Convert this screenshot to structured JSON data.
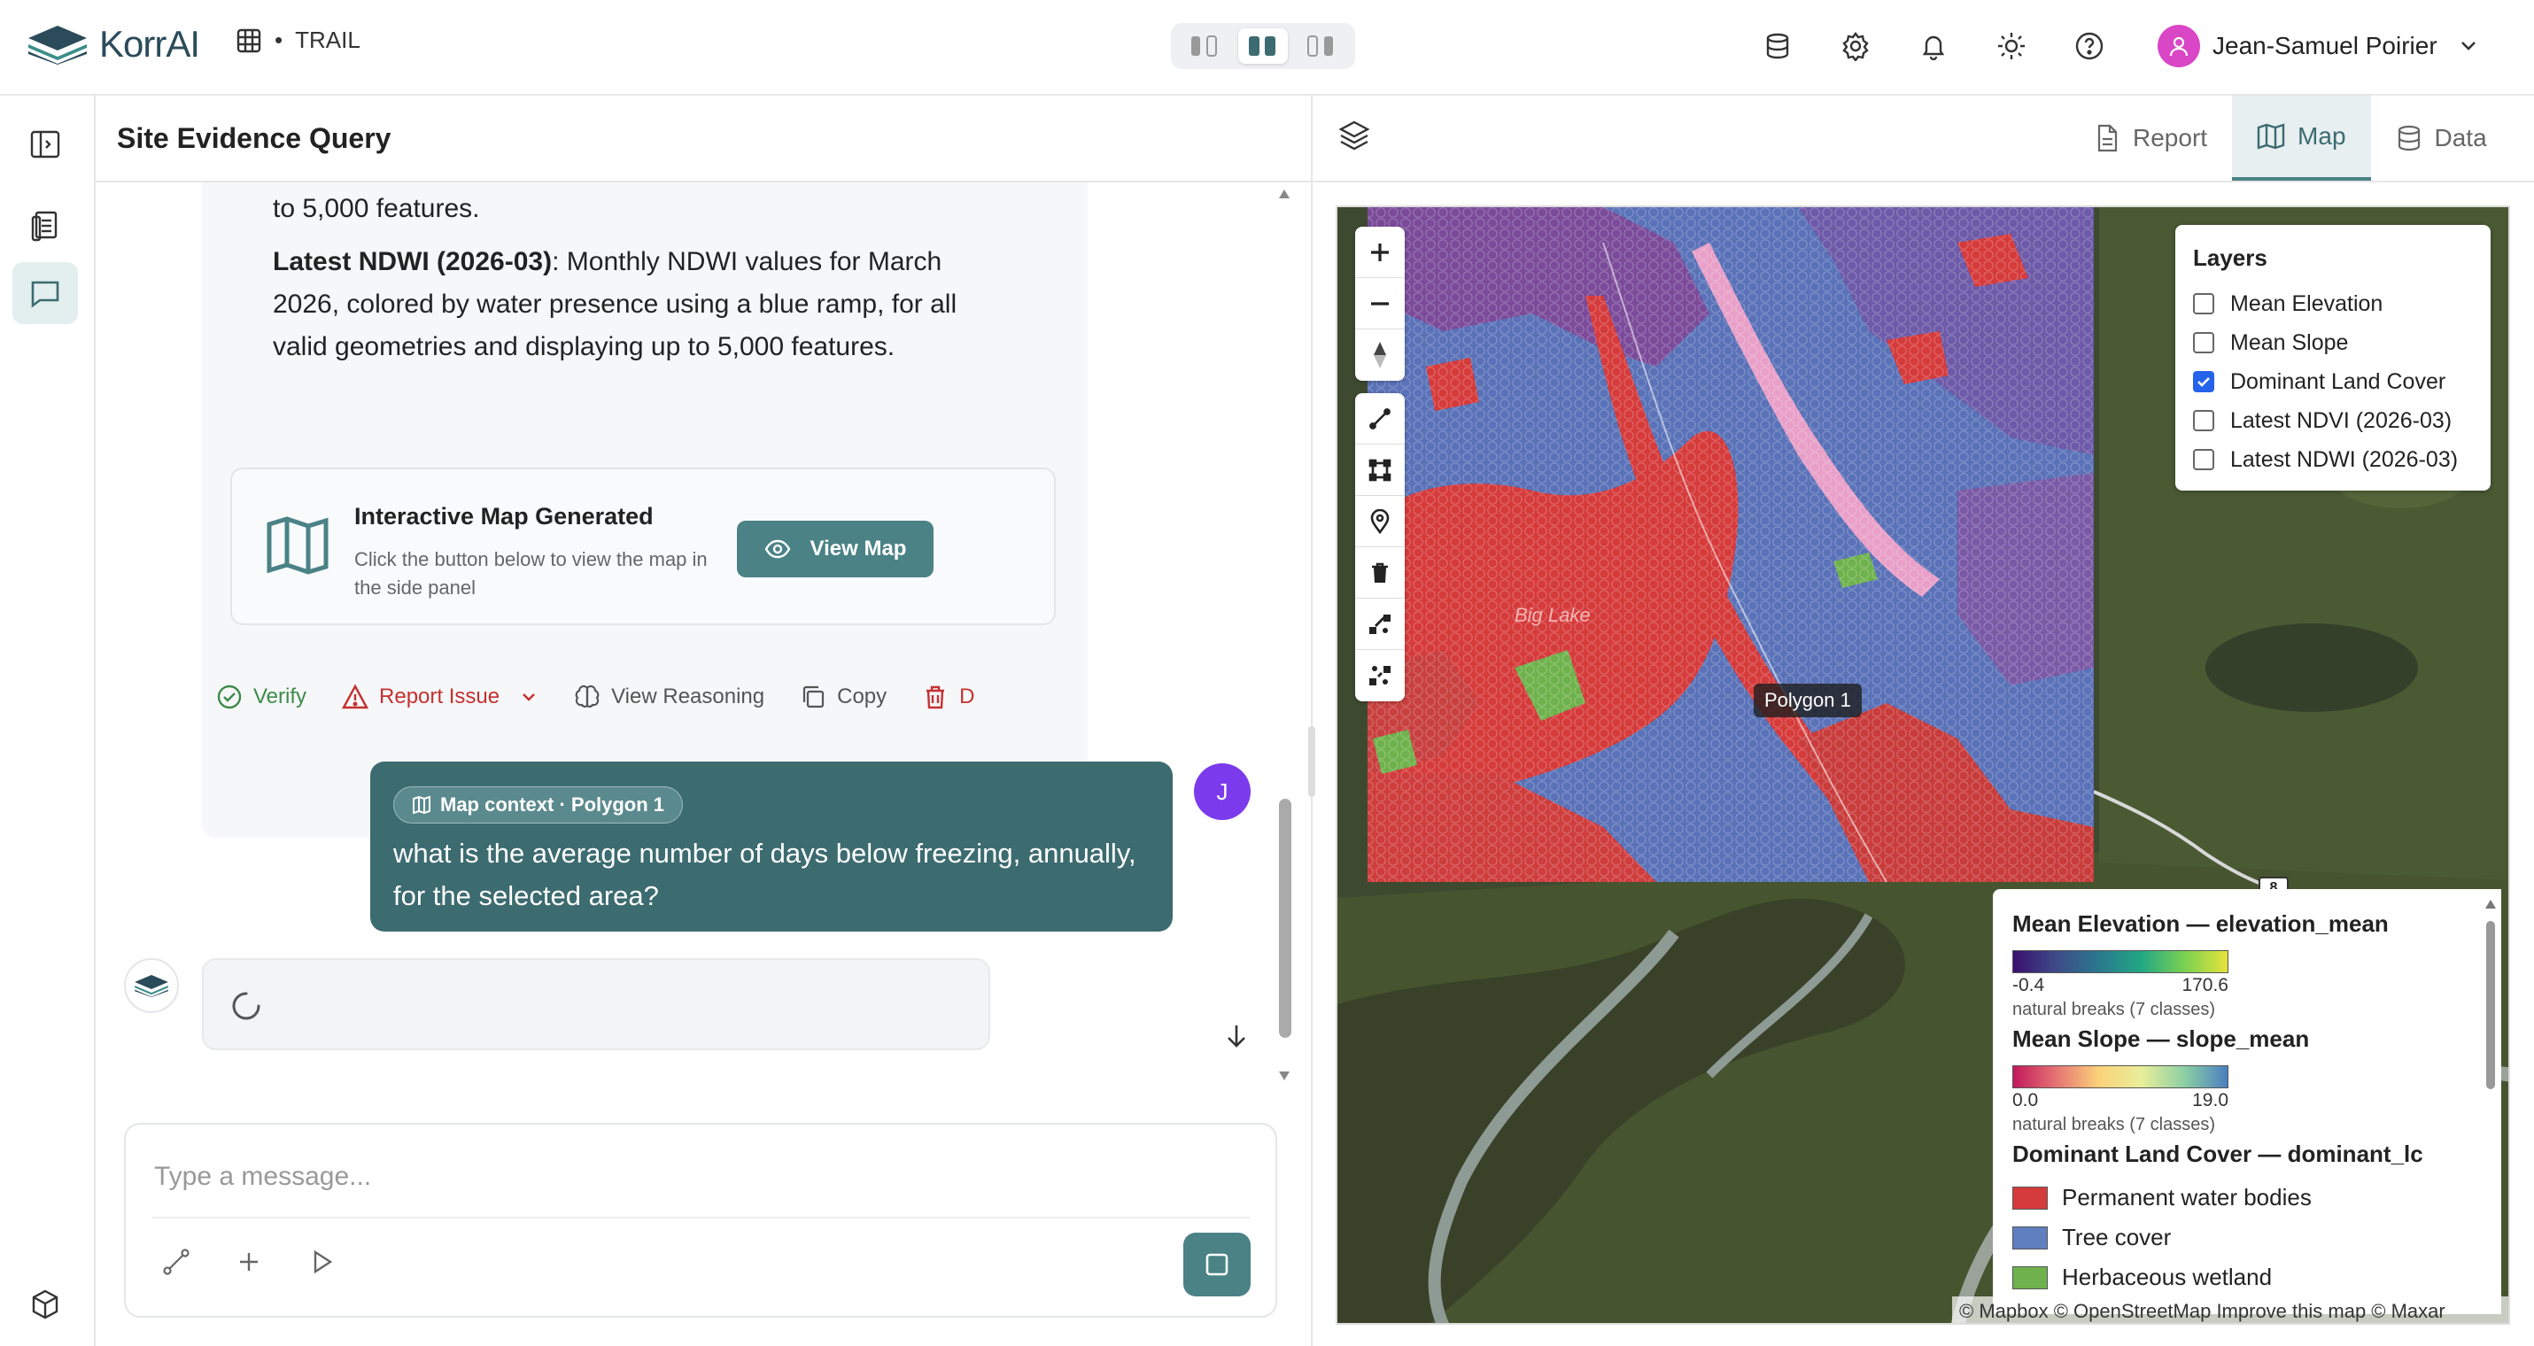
{
  "app": {
    "brand": "KorrAI",
    "workspace": "TRAIL",
    "user_name": "Jean-Samuel Poirier"
  },
  "chat": {
    "title": "Site Evidence Query",
    "assistant_msg": {
      "line_top": "to 5,000 features.",
      "ndwi_label": "Latest NDWI (2026-03)",
      "ndwi_text": ": Monthly NDWI values for March 2026, colored by water presence using a blue ramp, for all valid geometries and displaying up to 5,000 features.",
      "map_card_title": "Interactive Map Generated",
      "map_card_sub": "Click the button below to view the map in the side panel",
      "view_map_label": "View Map"
    },
    "actions": {
      "verify": "Verify",
      "report_issue": "Report Issue",
      "view_reasoning": "View Reasoning",
      "copy": "Copy",
      "delete": "D"
    },
    "user_msg": {
      "context_pill": "Map context · Polygon 1",
      "text": "what is the average number of days below freezing, annually, for the selected area?",
      "avatar_letter": "J"
    },
    "composer_placeholder": "Type a message..."
  },
  "panel": {
    "tabs": [
      "Report",
      "Map",
      "Data"
    ],
    "active_tab": "Map"
  },
  "map": {
    "polygon_label": "Polygon 1",
    "place_label": "Big Lake",
    "road_shield": "8",
    "layers_title": "Layers",
    "layers": [
      {
        "label": "Mean Elevation",
        "checked": false
      },
      {
        "label": "Mean Slope",
        "checked": false
      },
      {
        "label": "Dominant Land Cover",
        "checked": true
      },
      {
        "label": "Latest NDVI (2026-03)",
        "checked": false
      },
      {
        "label": "Latest NDWI (2026-03)",
        "checked": false
      }
    ],
    "legend": {
      "elevation_title": "Mean Elevation — elevation_mean",
      "elevation_min": "-0.4",
      "elevation_max": "170.6",
      "elevation_note": "natural breaks (7 classes)",
      "slope_title": "Mean Slope — slope_mean",
      "slope_min": "0.0",
      "slope_max": "19.0",
      "slope_note": "natural breaks (7 classes)",
      "landcover_title": "Dominant Land Cover — dominant_lc",
      "landcover_classes": [
        {
          "label": "Permanent water bodies",
          "color": "#d63b3b"
        },
        {
          "label": "Tree cover",
          "color": "#5f7fbf"
        },
        {
          "label": "Herbaceous wetland",
          "color": "#6fb24d"
        }
      ]
    },
    "attribution": "© Mapbox © OpenStreetMap  Improve this map © Maxar"
  },
  "colors": {
    "accent": "#4a8286",
    "user_bubble": "#3c6b70",
    "water": "#d63b3b",
    "tree": "#5f7fbf",
    "wetland": "#6fb24d",
    "urban": "#e8a0c8"
  }
}
